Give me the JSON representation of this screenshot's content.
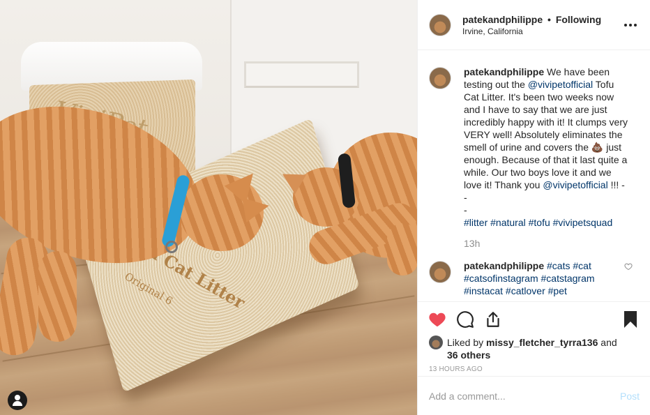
{
  "post": {
    "username": "patekandphilippe",
    "following_label": "Following",
    "location": "Irvine, California"
  },
  "photo": {
    "box_back_text": "ViviPet",
    "box_front_title": "Tofu Cat Litter",
    "box_front_sub": "Original 6"
  },
  "caption": {
    "username": "patekandphilippe",
    "parts": {
      "p1": "We have been testing out the ",
      "mention1": "@vivipetofficial",
      "p2": " Tofu Cat Litter. It's been two weeks now and I have to say that we are just incredibly happy with it! It clumps very VERY well! Absolutely eliminates the smell of urine and covers the ",
      "emoji": "💩",
      "p3": " just enough. Because of that it last quite a while. Our two boys love it and we love it! Thank you ",
      "mention2": "@vivipetofficial",
      "p4": " !!! -",
      "line2": "-",
      "line3": "-",
      "hashtags": "#litter #natural #tofu #vivipetsquad"
    },
    "time": "13h"
  },
  "comment2": {
    "username": "patekandphilippe",
    "line1": "#cats #cat",
    "line2": "#catsofinstagram #catstagram",
    "line3": "#instacat #catlover #pet"
  },
  "likes": {
    "prefix": "Liked by ",
    "user": "missy_fletcher_tyrra136",
    "and": " and",
    "others": "36 others"
  },
  "date": "13 HOURS AGO",
  "add_comment": {
    "placeholder": "Add a comment...",
    "post_label": "Post"
  },
  "colors": {
    "like_red": "#ed4956",
    "link_blue": "#003569",
    "post_button_disabled": "#b2dffc"
  }
}
